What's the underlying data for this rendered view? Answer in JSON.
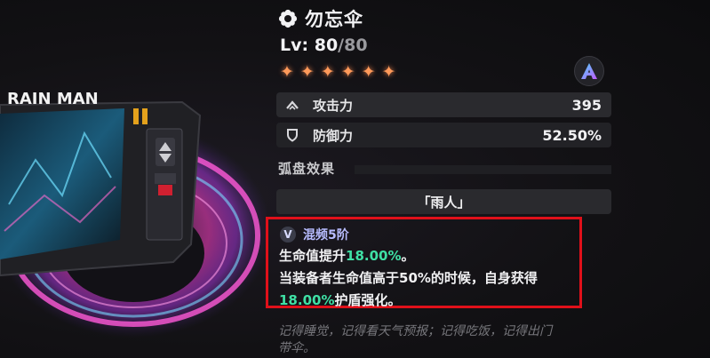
{
  "item": {
    "icon": "flower-gear-icon",
    "name": "勿忘伞",
    "level_label": "Lv:",
    "level": "80",
    "level_max": "/80",
    "stars": 6,
    "star_glyph": "✦",
    "rank_badge_icon": "rank-a-icon"
  },
  "artwork": {
    "device_text": "RAIN MAN"
  },
  "stats": [
    {
      "icon": "attack-chevron-icon",
      "label": "攻击力",
      "value": "395"
    },
    {
      "icon": "shield-icon",
      "label": "防御力",
      "value": "52.50%"
    }
  ],
  "set_section": {
    "title": "弧盘效果",
    "set_name": "「雨人」"
  },
  "effect": {
    "badge": "V",
    "name": "混频5阶",
    "line1_pre": "生命值提升",
    "line1_val": "18.00%",
    "line1_post": "。",
    "line2": "当装备者生命值高于50%的时候，自身获得",
    "line3_val": "18.00%",
    "line3_post": "护盾强化。"
  },
  "flavor": {
    "line1": "记得睡觉，记得看天气预报；记得吃饭，记得出门",
    "line2": "带伞。"
  },
  "colors": {
    "highlight": "#3fe0a5",
    "star": "#ff9a5a",
    "effect_border": "#e0101a",
    "effect_name": "#b7bcff"
  }
}
